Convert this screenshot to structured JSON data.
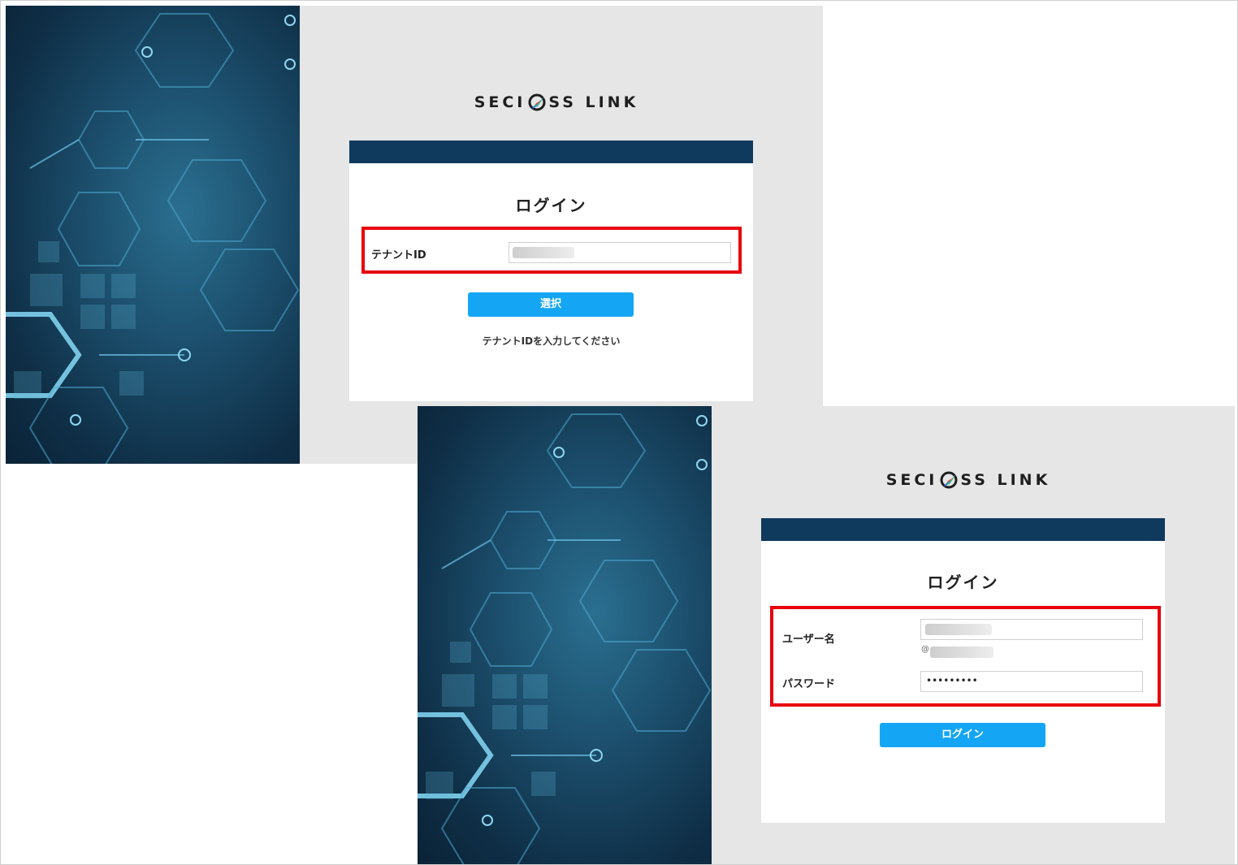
{
  "screens": [
    {
      "logo": {
        "left": "SECI",
        "right": "SS LINK"
      },
      "title": "ログイン",
      "fields": [
        {
          "label": "テナントID",
          "value": ""
        }
      ],
      "button": "選択",
      "helper": "テナントIDを入力してください"
    },
    {
      "logo": {
        "left": "SECI",
        "right": "SS LINK"
      },
      "title": "ログイン",
      "fields": [
        {
          "label": "ユーザー名",
          "value": "",
          "suffix": "@"
        },
        {
          "label": "パスワード",
          "value": "•••••••••"
        }
      ],
      "button": "ログイン"
    }
  ],
  "colors": {
    "card_header": "#0f3a5e",
    "button": "#14a6f5",
    "highlight": "#e8000c"
  }
}
